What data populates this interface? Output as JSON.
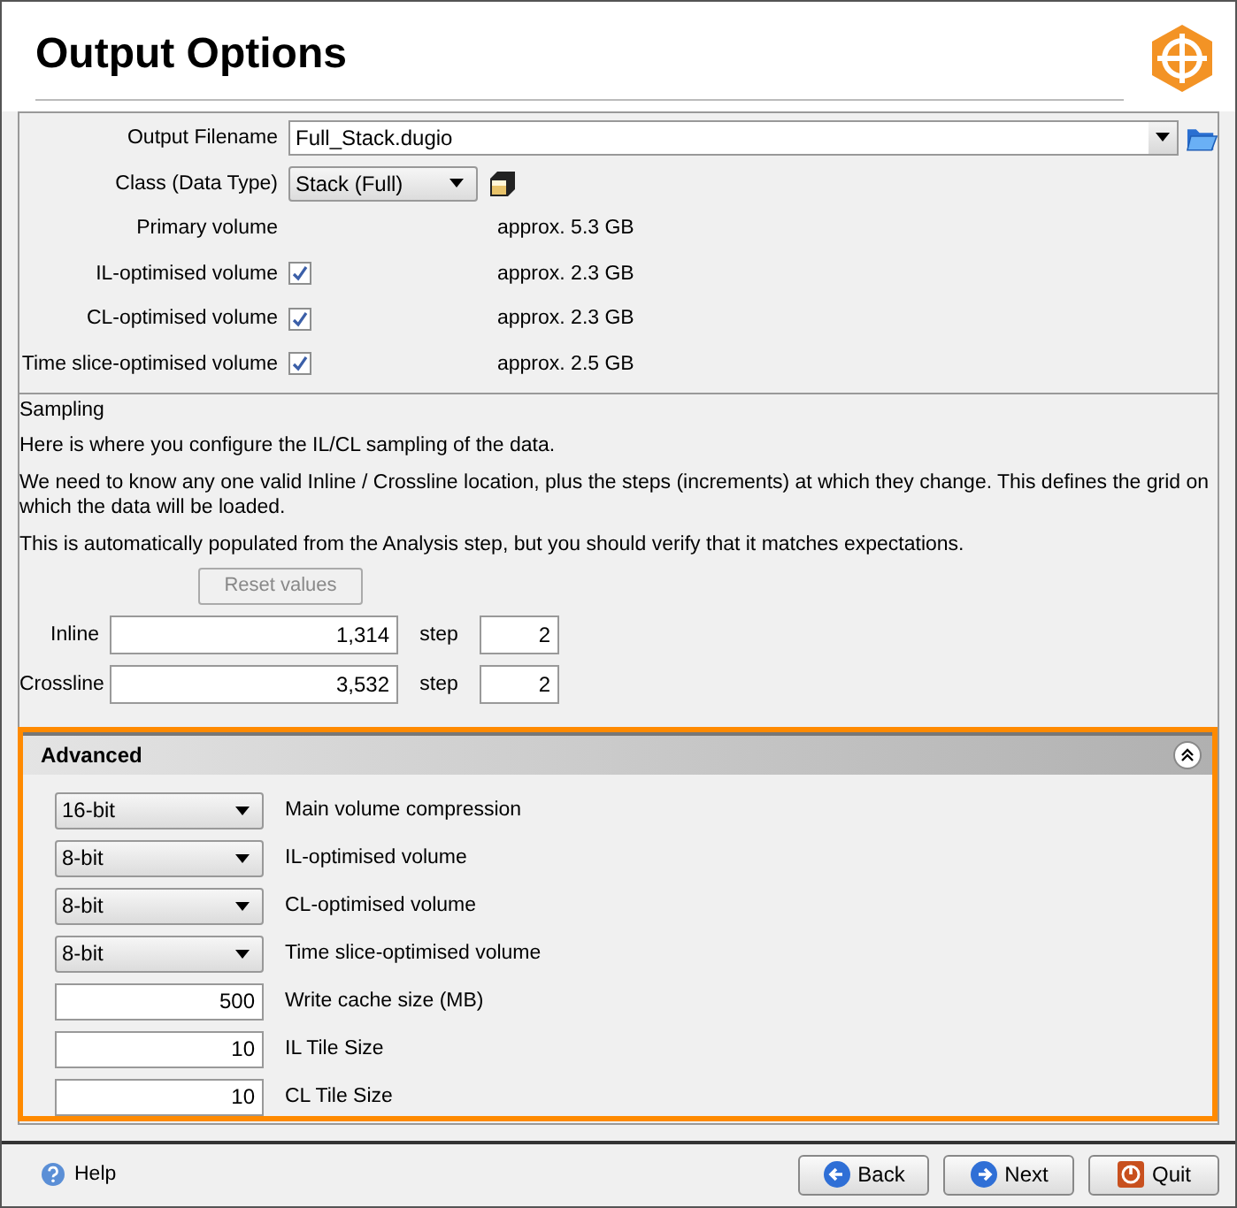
{
  "title": "Output Options",
  "output": {
    "filename_label": "Output Filename",
    "filename": "Full_Stack.dugio",
    "class_label": "Class (Data Type)",
    "class_value": "Stack (Full)",
    "volumes": [
      {
        "label": "Primary volume",
        "kind": "plain",
        "size": "approx. 5.3 GB"
      },
      {
        "label": "IL-optimised volume",
        "kind": "checkbox",
        "checked": true,
        "size": "approx. 2.3 GB"
      },
      {
        "label": "CL-optimised volume",
        "kind": "checkbox",
        "checked": true,
        "size": "approx. 2.3 GB"
      },
      {
        "label": "Time slice-optimised volume",
        "kind": "checkbox",
        "checked": true,
        "size": "approx. 2.5 GB"
      }
    ]
  },
  "sampling": {
    "title": "Sampling",
    "paragraphs": [
      "Here is where you configure the IL/CL sampling of the data.",
      "We need to know any one valid Inline / Crossline location, plus the steps (increments) at which they change. This defines the grid on which the data will be loaded.",
      "This is automatically populated from the Analysis step, but you should verify that it matches expectations."
    ],
    "reset_button": {
      "label": "Reset values",
      "disabled": true
    },
    "rows": [
      {
        "label": "Inline",
        "value": "1,314",
        "step_label": "step",
        "step": "2"
      },
      {
        "label": "Crossline",
        "value": "3,532",
        "step_label": "step",
        "step": "2"
      }
    ]
  },
  "advanced": {
    "title": "Advanced",
    "expanded": true,
    "settings": [
      {
        "kind": "dropdown",
        "value": "16-bit",
        "label": "Main volume compression"
      },
      {
        "kind": "dropdown",
        "value": "8-bit",
        "label": "IL-optimised volume"
      },
      {
        "kind": "dropdown",
        "value": "8-bit",
        "label": "CL-optimised volume"
      },
      {
        "kind": "dropdown",
        "value": "8-bit",
        "label": "Time slice-optimised volume"
      },
      {
        "kind": "number",
        "value": "500",
        "label": "Write cache size (MB)"
      },
      {
        "kind": "number",
        "value": "10",
        "label": "IL Tile Size"
      },
      {
        "kind": "number",
        "value": "10",
        "label": "CL Tile Size"
      }
    ]
  },
  "footer": {
    "help": "Help",
    "buttons": [
      {
        "kind": "back",
        "label": "Back"
      },
      {
        "kind": "next",
        "label": "Next"
      },
      {
        "kind": "quit",
        "label": "Quit"
      }
    ]
  }
}
